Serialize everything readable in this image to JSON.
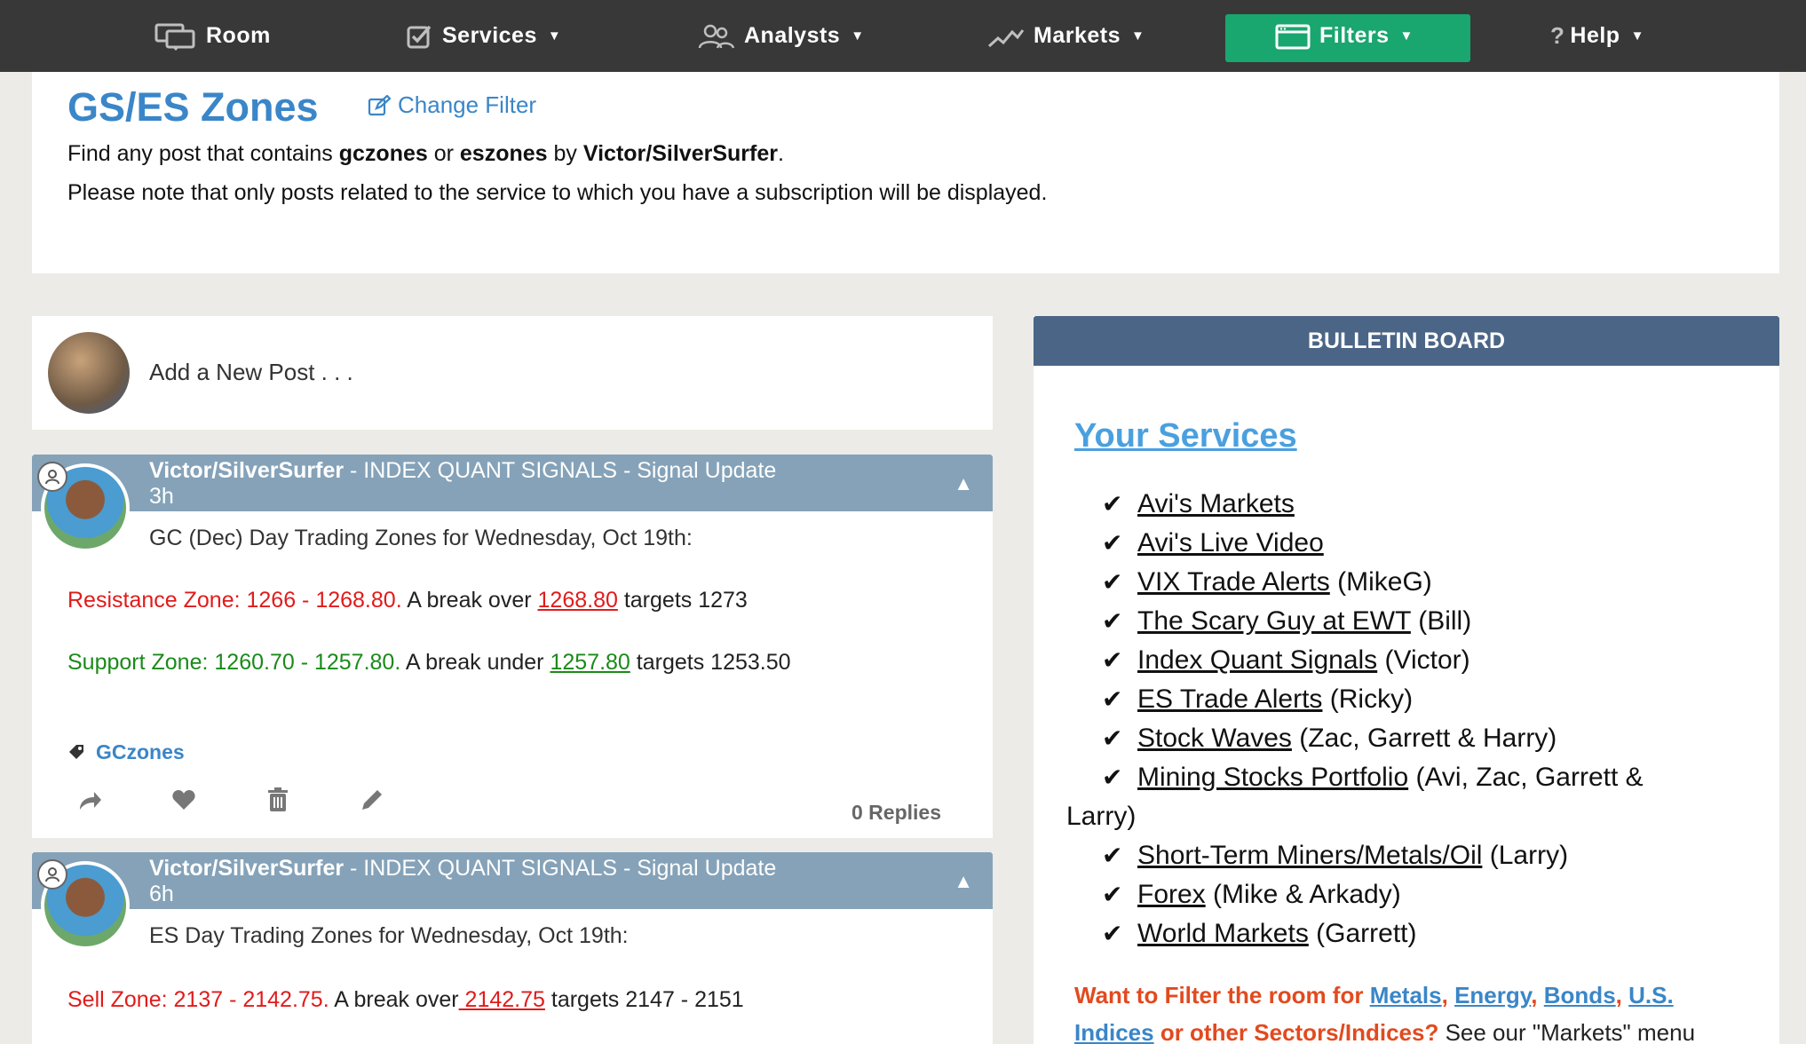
{
  "nav": {
    "items": [
      {
        "label": "Room",
        "icon": "chat-icon"
      },
      {
        "label": "Services",
        "icon": "checkbox-icon"
      },
      {
        "label": "Analysts",
        "icon": "people-icon"
      },
      {
        "label": "Markets",
        "icon": "trend-icon"
      },
      {
        "label": "Filters",
        "icon": "window-icon"
      },
      {
        "label": "Help",
        "icon": "question-icon"
      }
    ],
    "active_color": "#19a66f"
  },
  "header": {
    "title": "GS/ES Zones",
    "change_filter": "Change Filter",
    "desc1_pre": "Find any post that contains ",
    "desc1_b1": "gczones",
    "desc1_or": " or ",
    "desc1_b2": "eszones",
    "desc1_by": " by ",
    "desc1_b3": "Victor/SilverSurfer",
    "desc1_end": ".",
    "desc2": "Please note that only posts related to the service to which you have a subscription will be displayed."
  },
  "new_post": {
    "placeholder": "Add a New Post . . ."
  },
  "posts": [
    {
      "author": "Victor/SilverSurfer",
      "service": " - INDEX QUANT SIGNALS - Signal Update",
      "time": "3h",
      "intro": "GC  (Dec) Day Trading Zones for Wednesday, Oct 19th:",
      "r_label": "Resistance Zone:  1266 -  1268.80.",
      "r_mid": "  A break over ",
      "r_link": "1268.80",
      "r_end": " targets 1273",
      "s_label": "Support Zone:  1260.70 - 1257.80.",
      "s_mid": "  A break under ",
      "s_link": "1257.80",
      "s_end": " targets 1253.50",
      "tag": "GCzones",
      "replies": "0 Replies"
    },
    {
      "author": "Victor/SilverSurfer",
      "service": " - INDEX QUANT SIGNALS - Signal Update",
      "time": "6h",
      "intro": "ES Day Trading Zones for Wednesday, Oct 19th:",
      "r_label": "Sell Zone:  2137 - 2142.75.",
      "r_mid": "  A break over",
      "r_link": " 2142.75",
      "r_end": " targets 2147 - 2151"
    }
  ],
  "bulletin": {
    "header": "BULLETIN BOARD",
    "title": "Your Services",
    "services": [
      {
        "link": "Avi's Markets",
        "rest": ""
      },
      {
        "link": "Avi's Live Video",
        "rest": ""
      },
      {
        "link": "VIX Trade Alerts",
        "rest": " (MikeG)"
      },
      {
        "link": "The Scary Guy at EWT",
        "rest": " (Bill)"
      },
      {
        "link": "Index Quant Signals",
        "rest": " (Victor)"
      },
      {
        "link": "ES Trade Alerts",
        "rest": " (Ricky)"
      },
      {
        "link": "Stock Waves",
        "rest": " (Zac, Garrett & Harry)"
      },
      {
        "link": "Mining Stocks Portfolio",
        "rest": " (Avi, Zac, Garrett &"
      },
      {
        "link": "Short-Term Miners/Metals/Oil",
        "rest": " (Larry)"
      },
      {
        "link": "Forex",
        "rest": " (Mike & Arkady)"
      },
      {
        "link": "World Markets",
        "rest": " (Garrett)"
      }
    ],
    "wrap_line": "Larry)",
    "cta_lead": "Want to Filter the room for ",
    "cta_metals": "Metals",
    "cta_energy": "Energy",
    "cta_bonds": "Bonds",
    "cta_us": "U.S.",
    "cta_indices": "Indices",
    "cta_other": " or other Sectors/Indices?",
    "cta_see": " See our \"Markets\" menu",
    "comma": ",",
    "space": " ",
    "check": "✔"
  }
}
